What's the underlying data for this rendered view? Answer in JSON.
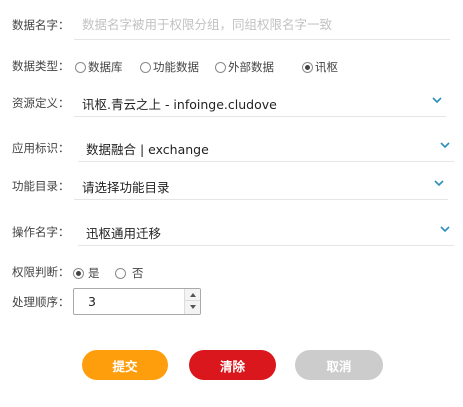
{
  "form": {
    "name": {
      "label": "数据名字：",
      "value": "",
      "placeholder": "数据名字被用于权限分组，同组权限名字一致"
    },
    "data_type": {
      "label": "数据类型：",
      "options": [
        {
          "label": "数据库",
          "checked": false
        },
        {
          "label": "功能数据",
          "checked": false
        },
        {
          "label": "外部数据",
          "checked": false
        },
        {
          "label": "讯枢",
          "checked": true
        }
      ]
    },
    "resource": {
      "label": "资源定义：",
      "value": "讯枢.青云之上 - infoinge.cludove"
    },
    "app_id": {
      "label": "应用标识：",
      "value": "数据融合 | exchange"
    },
    "function_dir": {
      "label": "功能目录：",
      "value": "请选择功能目录"
    },
    "operation_name": {
      "label": "操作名字：",
      "value": "迅枢通用迁移"
    },
    "permission_check": {
      "label": "权限判断：",
      "options": [
        {
          "label": "是",
          "checked": true
        },
        {
          "label": "否",
          "checked": false
        }
      ]
    },
    "order": {
      "label": "处理顺序：",
      "value": "3"
    }
  },
  "buttons": {
    "submit": {
      "label": "提交",
      "color": "#ff9e0d"
    },
    "clear": {
      "label": "清除",
      "color": "#d9171c"
    },
    "cancel": {
      "label": "取消",
      "color": "#cccccc"
    }
  },
  "icons": {
    "select_arrow": "chevron-down-icon",
    "select_arrow_color": "#2a8fbd"
  }
}
